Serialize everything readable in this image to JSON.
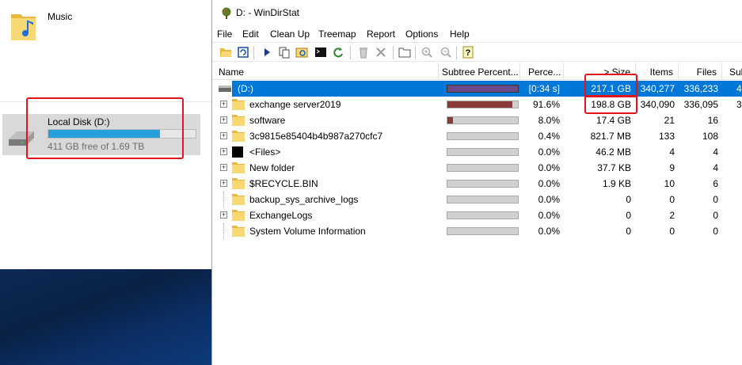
{
  "explorer": {
    "music_label": "Music",
    "disk": {
      "name": "Local Disk (D:)",
      "free_text": "411 GB free of 1.69 TB",
      "used_fraction": 0.76,
      "bar_color": "#26a0da"
    }
  },
  "window": {
    "title": "D: - WinDirStat",
    "app_icon": "tree-icon"
  },
  "menu": [
    {
      "label": "File"
    },
    {
      "label": "Edit"
    },
    {
      "label": "Clean Up"
    },
    {
      "label": "Treemap"
    },
    {
      "label": "Report"
    },
    {
      "label": "Options"
    },
    {
      "label": "Help"
    }
  ],
  "toolbar": [
    {
      "icon": "open-folder-icon"
    },
    {
      "icon": "refresh-icon"
    },
    {
      "icon": "play-icon"
    },
    {
      "icon": "copy-icon"
    },
    {
      "icon": "explorer-icon"
    },
    {
      "icon": "command-prompt-icon"
    },
    {
      "icon": "refresh-selected-icon"
    },
    {
      "icon": "recycle-bin-icon"
    },
    {
      "icon": "delete-icon"
    },
    {
      "icon": "new-folder-icon"
    },
    {
      "icon": "zoom-in-icon"
    },
    {
      "icon": "zoom-out-icon"
    },
    {
      "icon": "help-icon"
    }
  ],
  "columns": {
    "name": "Name",
    "subtree": "Subtree Percent...",
    "percent": "Perce...",
    "size": "> Size",
    "items": "Items",
    "files": "Files",
    "subdirs": "Sub"
  },
  "rows": [
    {
      "name": "(D:)",
      "percent": "[0:34 s]",
      "size": "217.1 GB",
      "items": "340,277",
      "files": "336,233",
      "subdirs": "4",
      "bar_fraction": 1.0,
      "selected": true,
      "expander": false,
      "icon": "drive-icon"
    },
    {
      "name": "exchange server2019",
      "percent": "91.6%",
      "size": "198.8 GB",
      "items": "340,090",
      "files": "336,095",
      "subdirs": "3",
      "bar_fraction": 0.916,
      "expander": true,
      "icon": "folder-icon"
    },
    {
      "name": "software",
      "percent": "8.0%",
      "size": "17.4 GB",
      "items": "21",
      "files": "16",
      "subdirs": "",
      "bar_fraction": 0.08,
      "expander": true,
      "icon": "folder-icon"
    },
    {
      "name": "3c9815e85404b4b987a270cfc7",
      "percent": "0.4%",
      "size": "821.7 MB",
      "items": "133",
      "files": "108",
      "subdirs": "",
      "bar_fraction": 0.004,
      "expander": true,
      "icon": "folder-icon"
    },
    {
      "name": "<Files>",
      "percent": "0.0%",
      "size": "46.2 MB",
      "items": "4",
      "files": "4",
      "subdirs": "",
      "bar_fraction": 0.0,
      "expander": true,
      "icon": "files-icon"
    },
    {
      "name": "New folder",
      "percent": "0.0%",
      "size": "37.7 KB",
      "items": "9",
      "files": "4",
      "subdirs": "",
      "bar_fraction": 0.0,
      "expander": true,
      "icon": "folder-icon"
    },
    {
      "name": "$RECYCLE.BIN",
      "percent": "0.0%",
      "size": "1.9 KB",
      "items": "10",
      "files": "6",
      "subdirs": "",
      "bar_fraction": 0.0,
      "expander": true,
      "icon": "folder-icon"
    },
    {
      "name": "backup_sys_archive_logs",
      "percent": "0.0%",
      "size": "0",
      "items": "0",
      "files": "0",
      "subdirs": "",
      "bar_fraction": 0.0,
      "expander": false,
      "icon": "folder-icon"
    },
    {
      "name": "ExchangeLogs",
      "percent": "0.0%",
      "size": "0",
      "items": "2",
      "files": "0",
      "subdirs": "",
      "bar_fraction": 0.0,
      "expander": true,
      "icon": "folder-icon"
    },
    {
      "name": "System Volume Information",
      "percent": "0.0%",
      "size": "0",
      "items": "0",
      "files": "0",
      "subdirs": "",
      "bar_fraction": 0.0,
      "expander": false,
      "icon": "folder-icon"
    }
  ],
  "colors": {
    "selection": "#0078d7",
    "bar_fill": "#8b3a3a",
    "highlight": "#e3151b",
    "folder": "#f8d775"
  }
}
